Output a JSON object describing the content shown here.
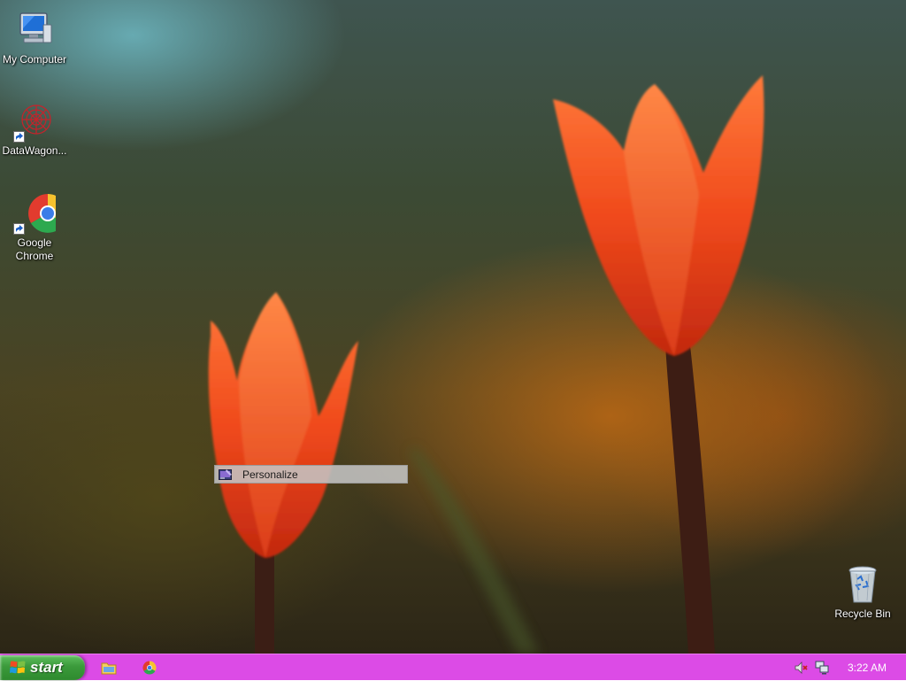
{
  "desktop": {
    "icons": [
      {
        "label": "My Computer",
        "icon": "my-computer-icon"
      },
      {
        "label": "DataWagon...",
        "icon": "datawagon-icon"
      },
      {
        "label_line1": "Google",
        "label_line2": "Chrome",
        "icon": "chrome-icon"
      },
      {
        "label": "Recycle Bin",
        "icon": "recycle-bin-icon"
      }
    ]
  },
  "context_menu": {
    "items": [
      {
        "label": "Personalize",
        "icon": "personalize-icon"
      }
    ]
  },
  "taskbar": {
    "start_label": "start",
    "quick_launch": [
      {
        "icon": "file-explorer-icon"
      },
      {
        "icon": "chrome-icon"
      }
    ],
    "tray": {
      "icons": [
        "volume-muted-icon",
        "network-icon"
      ],
      "clock": "3:22 AM"
    },
    "background_color": "#dc4be6"
  }
}
